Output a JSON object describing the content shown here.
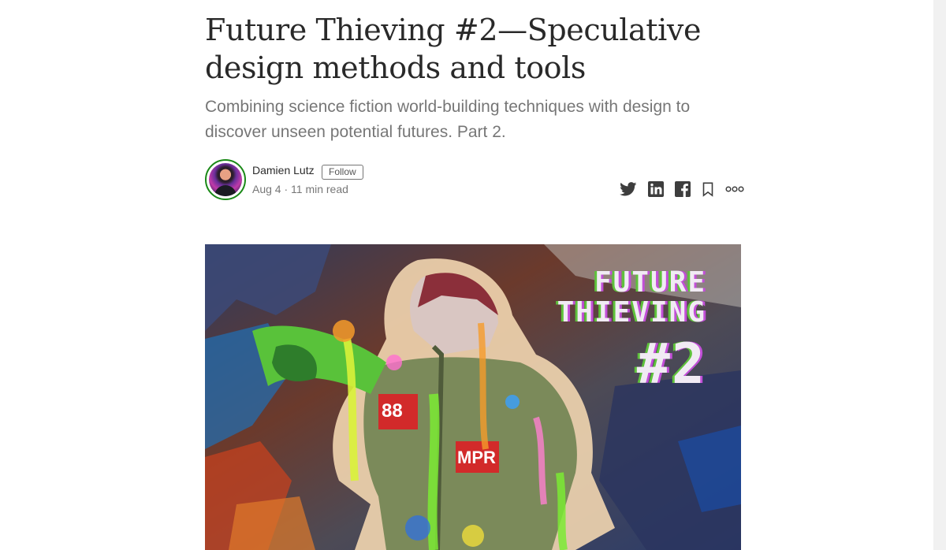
{
  "article": {
    "title": "Future Thieving #2—Speculative design methods and tools",
    "subtitle": "Combining science fiction world-building techniques with design to discover unseen potential futures. Part 2."
  },
  "byline": {
    "author": "Damien Lutz",
    "follow_label": "Follow",
    "meta": "Aug 4 · 11 min read"
  },
  "share_bar": {
    "icons": [
      "twitter-icon",
      "linkedin-icon",
      "facebook-icon",
      "bookmark-icon",
      "more-icon"
    ]
  },
  "hero": {
    "lines": [
      "FUTURE",
      "THIEVING",
      "#2"
    ],
    "badges": [
      "88",
      "MPR"
    ]
  },
  "colors": {
    "text": "#292929",
    "muted": "#757575",
    "accent_green": "#1a8917",
    "hero_purple": "#c24fd8",
    "hero_green": "#5ec23b"
  }
}
